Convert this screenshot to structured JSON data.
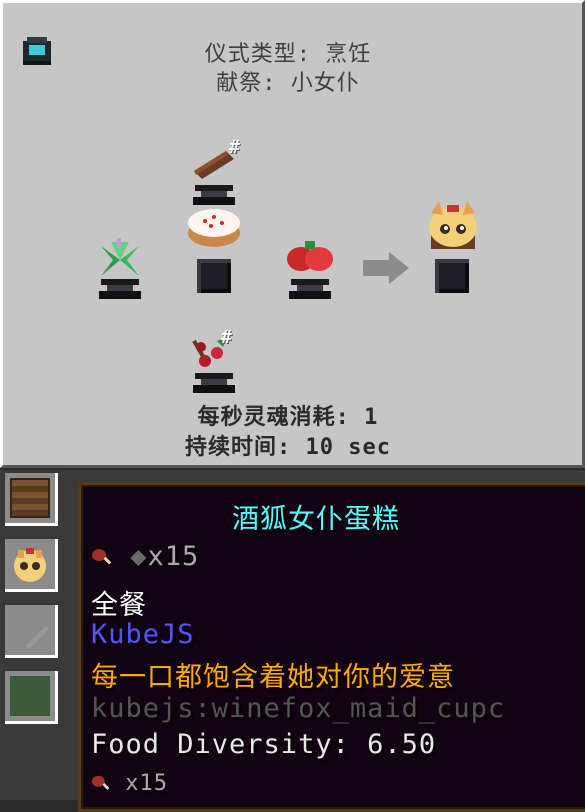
{
  "ritual": {
    "type_line": "仪式类型: 烹饪",
    "sacrifice_line": "献祭: 小女仆",
    "soul_cost_line": "每秒灵魂消耗: 1",
    "duration_line": "持续时间: 10 sec",
    "hash_symbol": "#"
  },
  "tooltip": {
    "title": "酒狐女仆蛋糕",
    "hunger": "x15",
    "tag": "全餐",
    "mod": "KubeJS",
    "lore": "每一口都饱含着她对你的爱意",
    "id": "kubejs:winefox_maid_cupc",
    "food_diversity": "Food Diversity: 6.50",
    "hunger_bottom": "x15"
  },
  "colors": {
    "title": "#55ffff",
    "mod": "#5555ff",
    "lore": "#ffaa00",
    "id": "#555555",
    "panel_bg": "#c6c6c6"
  },
  "icons": {
    "corner": "spirit-altar-icon",
    "left_ingredient": "green-herb-icon",
    "top_ingredient": "chocolate-bar-icon",
    "center_item": "cake-icon",
    "right_ingredient": "strawberries-icon",
    "bottom_ingredient": "berries-icon",
    "output": "winefox-maid-cupcake-icon",
    "arrow": "arrow-right-icon",
    "meat": "meat-drumstick-icon"
  }
}
